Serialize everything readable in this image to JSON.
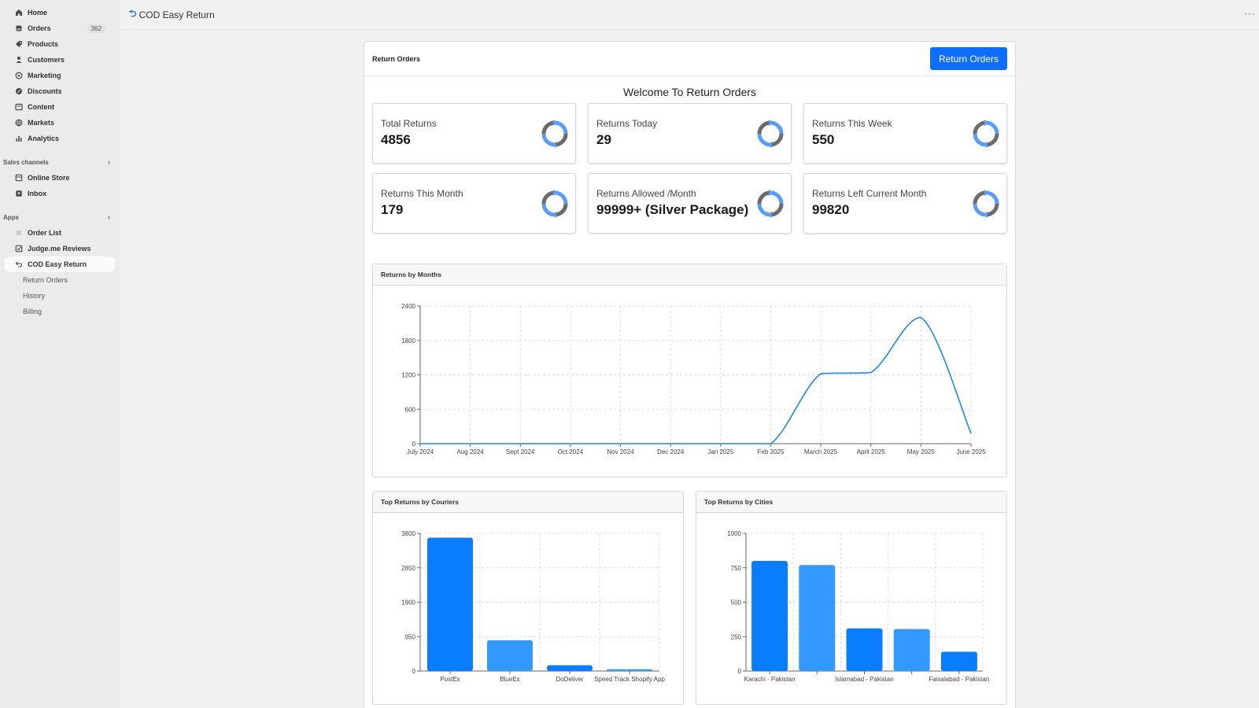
{
  "sidebar": {
    "items": [
      {
        "label": "Home",
        "icon": "home-icon"
      },
      {
        "label": "Orders",
        "icon": "orders-icon",
        "badge": "362"
      },
      {
        "label": "Products",
        "icon": "tag-icon"
      },
      {
        "label": "Customers",
        "icon": "person-icon"
      },
      {
        "label": "Marketing",
        "icon": "target-icon"
      },
      {
        "label": "Discounts",
        "icon": "discount-icon"
      },
      {
        "label": "Content",
        "icon": "content-icon"
      },
      {
        "label": "Markets",
        "icon": "globe-icon"
      },
      {
        "label": "Analytics",
        "icon": "bar-chart-icon"
      }
    ],
    "sales_channels_label": "Sales channels",
    "sales_channels": [
      {
        "label": "Online Store",
        "icon": "store-icon"
      },
      {
        "label": "Inbox",
        "icon": "inbox-icon"
      }
    ],
    "apps_label": "Apps",
    "apps": [
      {
        "label": "Order List",
        "icon": "list-icon"
      },
      {
        "label": "Judge.me Reviews",
        "icon": "judgeme-icon"
      },
      {
        "label": "COD Easy Return",
        "icon": "return-icon"
      }
    ],
    "sub_items": [
      "Return Orders",
      "History",
      "Billing"
    ]
  },
  "header": {
    "app_title": "COD Easy Return",
    "more_label": "···"
  },
  "panel": {
    "title": "Return Orders",
    "button_label": "Return Orders",
    "welcome": "Welcome To Return Orders"
  },
  "stats": [
    {
      "label": "Total Returns",
      "value": "4856"
    },
    {
      "label": "Returns Today",
      "value": "29"
    },
    {
      "label": "Returns This Week",
      "value": "550"
    },
    {
      "label": "Returns This Month",
      "value": "179"
    },
    {
      "label": "Returns Allowed /Month",
      "value": "99999+ (Silver Package)"
    },
    {
      "label": "Returns Left Current Month",
      "value": "99820"
    }
  ],
  "colors": {
    "accent": "#0d6efd",
    "bar_primary": "#0a7cff",
    "bar_secondary": "#3399ff",
    "line": "#1e88e5",
    "icon_blue": "#5b9cf5",
    "icon_gray": "#6b6b6b"
  },
  "chart_data": [
    {
      "type": "line",
      "title": "Returns by Months",
      "x": [
        "July 2024",
        "Aug 2024",
        "Sept 2024",
        "Oct 2024",
        "Nov 2024",
        "Dec 2024",
        "Jan 2025",
        "Feb 2025",
        "March 2025",
        "April 2025",
        "May 2025",
        "June 2025"
      ],
      "series": [
        {
          "values": [
            0,
            0,
            0,
            0,
            0,
            0,
            0,
            0,
            1220,
            1240,
            2200,
            180
          ]
        }
      ],
      "yticks": [
        0,
        600,
        1200,
        1800,
        2400
      ],
      "ylim": [
        0,
        2400
      ],
      "grid": true
    },
    {
      "type": "bar",
      "title": "Top Returns by Couriers",
      "categories": [
        "PostEx",
        "BlueEx",
        "DoDeliver",
        "Speed Track Shopify App"
      ],
      "values": [
        3680,
        850,
        160,
        50
      ],
      "yticks": [
        0,
        950,
        1900,
        2850,
        3800
      ],
      "ylim": [
        0,
        3800
      ],
      "grid": true
    },
    {
      "type": "bar",
      "title": "Top Returns by Cities",
      "categories": [
        "Karachi - Pakistan",
        "",
        "Islamabad - Pakistan",
        "",
        "Faisalabad - Pakistan"
      ],
      "values": [
        800,
        770,
        310,
        305,
        140
      ],
      "yticks": [
        0,
        250,
        500,
        750,
        1000
      ],
      "ylim": [
        0,
        1000
      ],
      "grid": true
    }
  ]
}
